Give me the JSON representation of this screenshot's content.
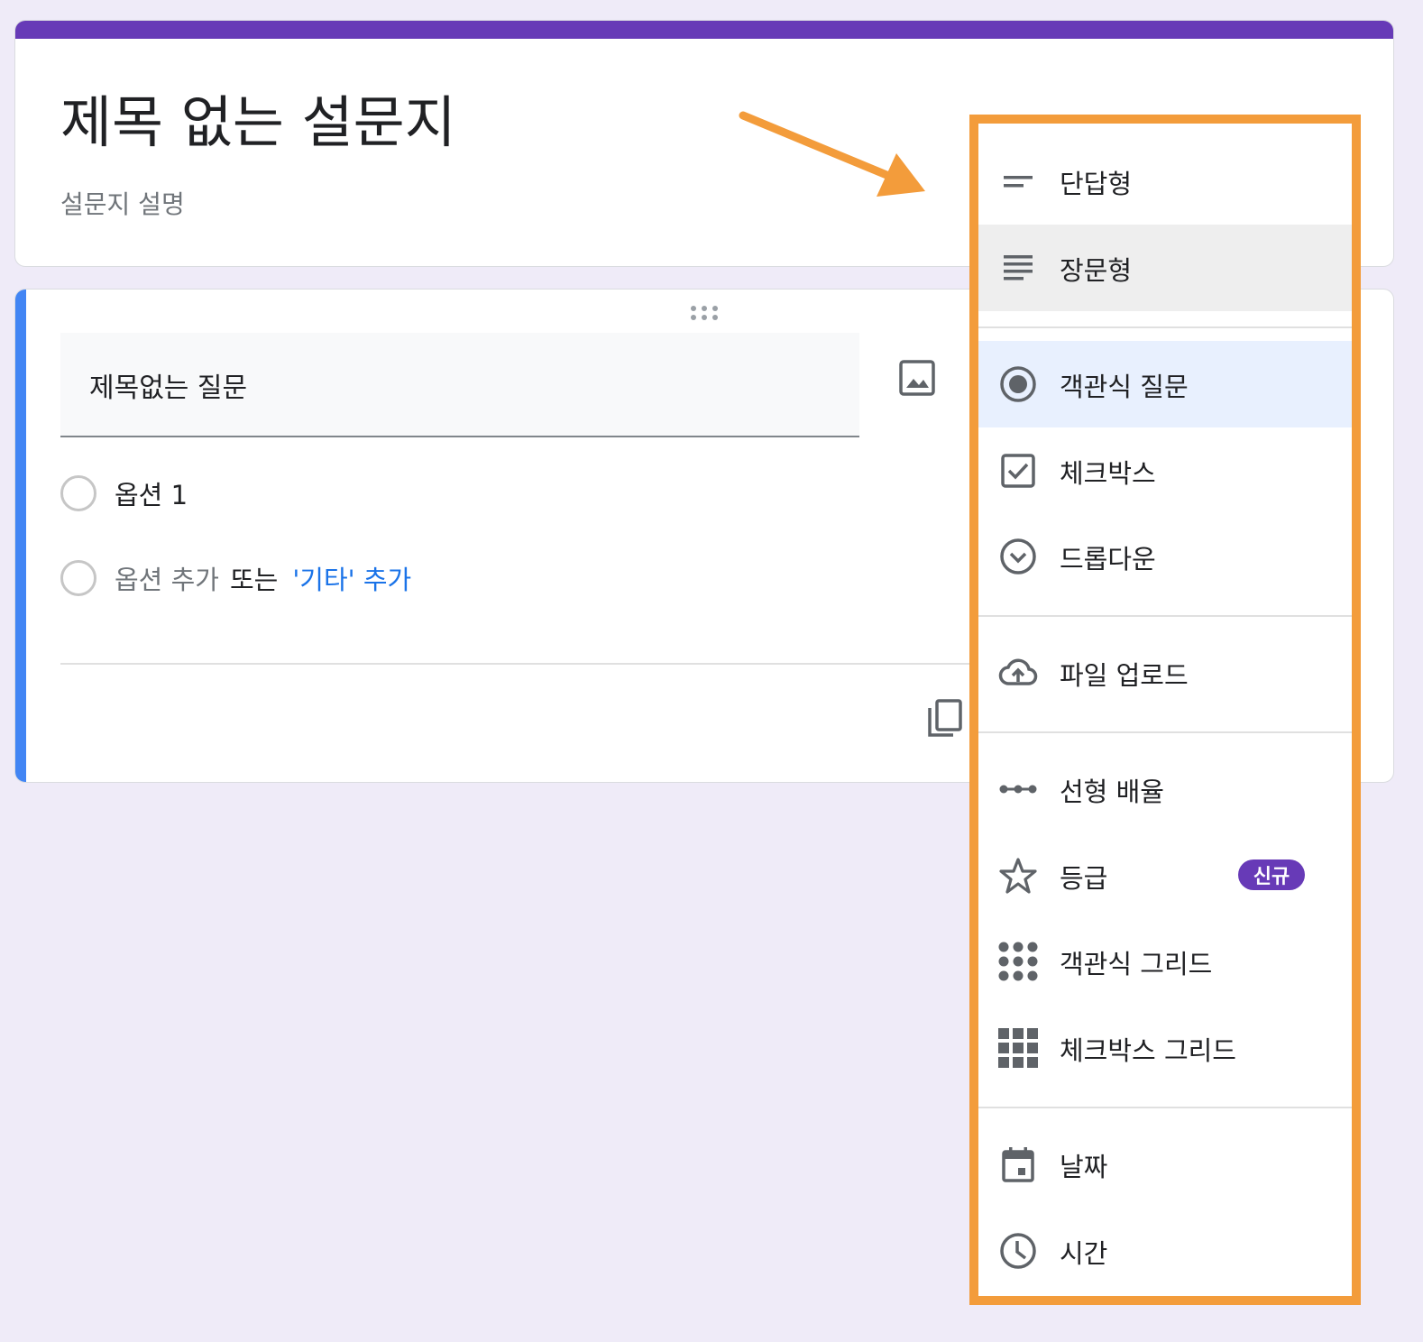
{
  "form": {
    "title": "제목 없는 설문지",
    "description": "설문지 설명"
  },
  "question": {
    "title": "제목없는 질문",
    "options": [
      {
        "label": "옵션 1"
      }
    ],
    "add_option": "옵션 추가",
    "or_text": "또는",
    "add_other": "'기타' 추가"
  },
  "type_menu": {
    "items": [
      {
        "label": "단답형",
        "icon": "short-answer-icon"
      },
      {
        "label": "장문형",
        "icon": "paragraph-icon",
        "state": "hover"
      },
      {
        "label": "객관식 질문",
        "icon": "radio-button-icon",
        "state": "selected"
      },
      {
        "label": "체크박스",
        "icon": "checkbox-icon"
      },
      {
        "label": "드롭다운",
        "icon": "dropdown-icon"
      },
      {
        "label": "파일 업로드",
        "icon": "cloud-upload-icon"
      },
      {
        "label": "선형 배율",
        "icon": "linear-scale-icon"
      },
      {
        "label": "등급",
        "icon": "star-icon",
        "badge": "신규"
      },
      {
        "label": "객관식 그리드",
        "icon": "dot-grid-icon"
      },
      {
        "label": "체크박스 그리드",
        "icon": "square-grid-icon"
      },
      {
        "label": "날짜",
        "icon": "calendar-icon"
      },
      {
        "label": "시간",
        "icon": "clock-icon"
      }
    ]
  },
  "colors": {
    "theme": "#673ab7",
    "focus_bar": "#4285f4",
    "highlight": "#f39c3b",
    "link": "#1a73e8",
    "background": "#efebf8"
  }
}
